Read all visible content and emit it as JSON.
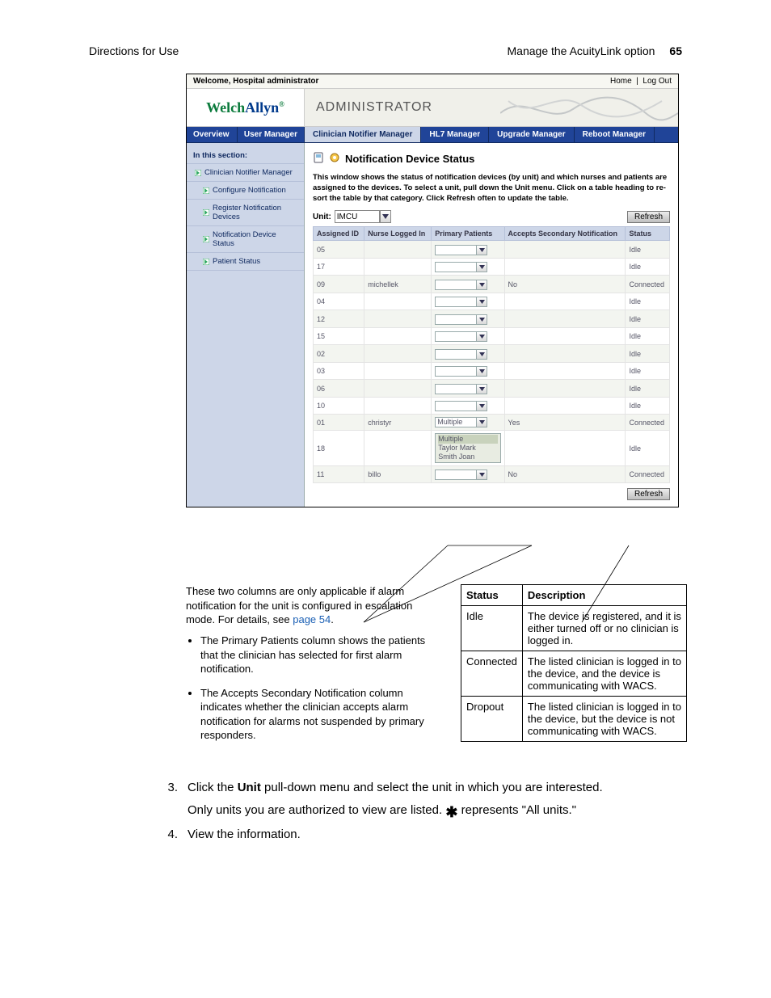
{
  "page_header": {
    "left": "Directions for Use",
    "right_title": "Manage the AcuityLink option",
    "page_number": "65"
  },
  "app": {
    "topbar": {
      "welcome": "Welcome, Hospital administrator",
      "home": "Home",
      "logout": "Log Out"
    },
    "logo": {
      "part1": "Welch",
      "part2": "Allyn",
      "sup": "®"
    },
    "admin_title": "ADMINISTRATOR",
    "tabs": {
      "overview": "Overview",
      "user_manager": "User Manager",
      "clinician_notifier": "Clinician Notifier Manager",
      "hl7": "HL7 Manager",
      "upgrade": "Upgrade Manager",
      "reboot": "Reboot Manager"
    },
    "sidebar": {
      "section_title": "In this section:",
      "items": [
        "Clinician Notifier Manager",
        "Configure Notification",
        "Register Notification Devices",
        "Notification Device Status",
        "Patient Status"
      ]
    },
    "content": {
      "title": "Notification Device Status",
      "desc": "This window shows the status of notification devices (by unit) and which nurses and patients are assigned to the devices. To select a unit, pull down the Unit menu. Click on a table heading to re-sort the table by that category. Click Refresh often to update the table.",
      "unit_label": "Unit:",
      "unit_value": "IMCU",
      "refresh": "Refresh",
      "columns": {
        "assigned_id": "Assigned ID",
        "nurse": "Nurse Logged In",
        "primary": "Primary Patients",
        "secondary": "Accepts Secondary Notification",
        "status": "Status"
      },
      "rows": [
        {
          "id": "05",
          "nurse": "",
          "primary": "",
          "secondary": "",
          "status": "Idle"
        },
        {
          "id": "17",
          "nurse": "",
          "primary": "",
          "secondary": "",
          "status": "Idle"
        },
        {
          "id": "09",
          "nurse": "michellek",
          "primary": "",
          "secondary": "No",
          "status": "Connected"
        },
        {
          "id": "04",
          "nurse": "",
          "primary": "",
          "secondary": "",
          "status": "Idle"
        },
        {
          "id": "12",
          "nurse": "",
          "primary": "",
          "secondary": "",
          "status": "Idle"
        },
        {
          "id": "15",
          "nurse": "",
          "primary": "",
          "secondary": "",
          "status": "Idle"
        },
        {
          "id": "02",
          "nurse": "",
          "primary": "",
          "secondary": "",
          "status": "Idle"
        },
        {
          "id": "03",
          "nurse": "",
          "primary": "",
          "secondary": "",
          "status": "Idle"
        },
        {
          "id": "06",
          "nurse": "",
          "primary": "",
          "secondary": "",
          "status": "Idle"
        },
        {
          "id": "10",
          "nurse": "",
          "primary": "",
          "secondary": "",
          "status": "Idle"
        },
        {
          "id": "01",
          "nurse": "christyr",
          "primary": "Multiple",
          "secondary": "Yes",
          "status": "Connected"
        },
        {
          "id": "18",
          "nurse": "",
          "primary_list": [
            "Multiple",
            "Taylor Mark",
            "Smith Joan"
          ],
          "secondary": "",
          "status": "Idle"
        },
        {
          "id": "11",
          "nurse": "billo",
          "primary": "",
          "secondary": "No",
          "status": "Connected"
        }
      ]
    }
  },
  "lower": {
    "intro": "These two columns are only applicable if alarm notification for the unit is configured in escalation mode. For details, see ",
    "page_link": "page 54",
    "intro_end": ".",
    "bullet1": "The Primary Patients column shows the patients that the clinician has selected for first alarm notification.",
    "bullet2": "The Accepts Secondary Notification column indicates whether the clinician accepts alarm notification for alarms not suspended by primary responders.",
    "status_table": {
      "h1": "Status",
      "h2": "Description",
      "rows": [
        {
          "s": "Idle",
          "d": "The device is registered, and it is either turned off or no clinician is logged in."
        },
        {
          "s": "Connected",
          "d": "The listed clinician is logged in to the device, and the device is communicating with WACS."
        },
        {
          "s": "Dropout",
          "d": "The listed clinician is logged in to the device, but the device is not communicating with WACS."
        }
      ]
    }
  },
  "steps": {
    "s3_num": "3.",
    "s3_text_a": "Click the ",
    "s3_bold": "Unit",
    "s3_text_b": " pull-down menu and select the unit in which you are interested.",
    "s3_sub": "Only units you are authorized to view are listed. ",
    "s3_sub_end": " represents \"All units.\"",
    "s4_num": "4.",
    "s4_text": "View the information."
  }
}
